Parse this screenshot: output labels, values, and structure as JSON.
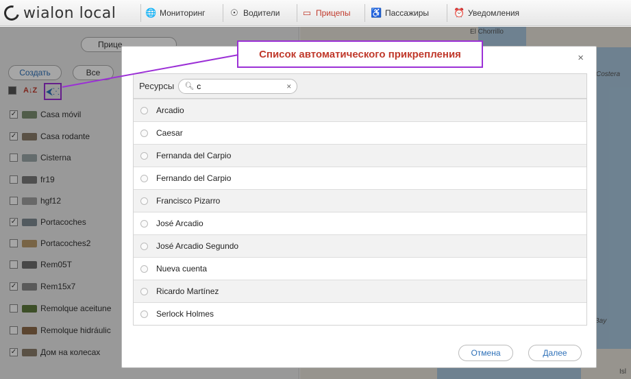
{
  "topbar": {
    "logo_text": "wialon local",
    "nav": [
      {
        "label": "Мониторинг",
        "icon": "globe-icon"
      },
      {
        "label": "Водители",
        "icon": "steering-wheel-icon"
      },
      {
        "label": "Прицепы",
        "icon": "trailer-icon",
        "active": true
      },
      {
        "label": "Пассажиры",
        "icon": "passenger-icon"
      },
      {
        "label": "Уведомления",
        "icon": "alarm-clock-icon"
      }
    ]
  },
  "left_panel": {
    "search_value": "Прице",
    "create_label": "Создать",
    "filter_label": "Все",
    "trailers": [
      {
        "name": "Casa móvil",
        "checked": true,
        "color": "#7d8f72"
      },
      {
        "name": "Casa rodante",
        "checked": true,
        "color": "#8b7d6b"
      },
      {
        "name": "Cisterna",
        "checked": false,
        "color": "#9aa6a8"
      },
      {
        "name": "fr19",
        "checked": false,
        "color": "#7a7a7a"
      },
      {
        "name": "hgf12",
        "checked": false,
        "color": "#a0a0a0"
      },
      {
        "name": "Portacoches",
        "checked": true,
        "color": "#7f8a93"
      },
      {
        "name": "Portacoches2",
        "checked": false,
        "color": "#b89a6a"
      },
      {
        "name": "Rem05T",
        "checked": false,
        "color": "#6f6f6f"
      },
      {
        "name": "Rem15x7",
        "checked": true,
        "color": "#8a8a8a"
      },
      {
        "name": "Remolque aceitune",
        "checked": false,
        "color": "#5f7a3e"
      },
      {
        "name": "Remolque hidráulic",
        "checked": false,
        "color": "#8c6a4a"
      },
      {
        "name": "Дом на колесах",
        "checked": true,
        "color": "#8b7d6b"
      }
    ]
  },
  "map": {
    "labels": [
      "El Chorrillo",
      "Costera",
      "Bay",
      "Isl"
    ]
  },
  "callout": {
    "text": "Список автоматического прикрепления"
  },
  "modal": {
    "close_glyph": "×",
    "resources_label": "Ресурсы",
    "search_value": "c",
    "clear_glyph": "×",
    "resources": [
      "Arcadio",
      "Caesar",
      "Fernanda del Carpio",
      "Fernando del Carpio",
      "Francisco Pizarro",
      "José Arcadio",
      "José Arcadio Segundo",
      "Nueva cuenta",
      "Ricardo Martínez",
      "Serlock Holmes"
    ],
    "cancel_label": "Отмена",
    "next_label": "Далее"
  },
  "colors": {
    "accent_link": "#2d70b8",
    "active_nav": "#c0392b",
    "highlight_frame": "#9b2fd6"
  }
}
